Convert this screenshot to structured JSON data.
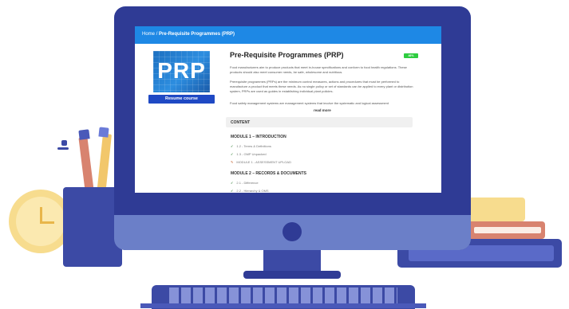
{
  "screen": {
    "breadcrumb": {
      "home": "Home",
      "separator": "/",
      "current": "Pre-Requisite Programmes (PRP)"
    },
    "course": {
      "thumbnail_text": "PRP",
      "resume_label": "Resume course",
      "title": "Pre-Requisite Programmes (PRP)",
      "progress_badge": "46%",
      "description": [
        "Food manufacturers aim to produce products that meet in-house specifications and conform to food health regulations. These products should also meet consumer needs, be safe, wholesome and nutritious.",
        "Prerequisite programmes (PRPs) are the minimum control measures, actions and procedures that must be performed to manufacture a product that meets these needs. As no single policy or set of standards can be applied to every plant or distribution system, PRPs are used as guides in establishing individual plant policies.",
        "Food safety management systems are management systems that involve the systematic and logical assessment"
      ],
      "read_more": "read more"
    },
    "content_label": "CONTENT",
    "modules": [
      {
        "title": "MODULE 1 – INTRODUCTION",
        "lessons": [
          {
            "label": "1.2 - Terms & Definitions",
            "icon": "check-icon"
          },
          {
            "label": "1.3 - GMP Unpacked",
            "icon": "check-icon"
          },
          {
            "label": "MODULE 1 - ASSESSMENT UPLOAD",
            "icon": "pencil-icon"
          }
        ]
      },
      {
        "title": "MODULE 2 – RECORDS & DOCUMENTS",
        "lessons": [
          {
            "label": "2.1 - Difference",
            "icon": "check-icon"
          },
          {
            "label": "2.2 - Hierarchy & OMS",
            "icon": "check-icon"
          }
        ]
      }
    ]
  },
  "colors": {
    "topbar": "#1e88e5",
    "resume_button": "#1f49c4",
    "badge": "#2ecc40",
    "monitor": "#2f3b95",
    "monitor_chin": "#6b7fc8"
  }
}
